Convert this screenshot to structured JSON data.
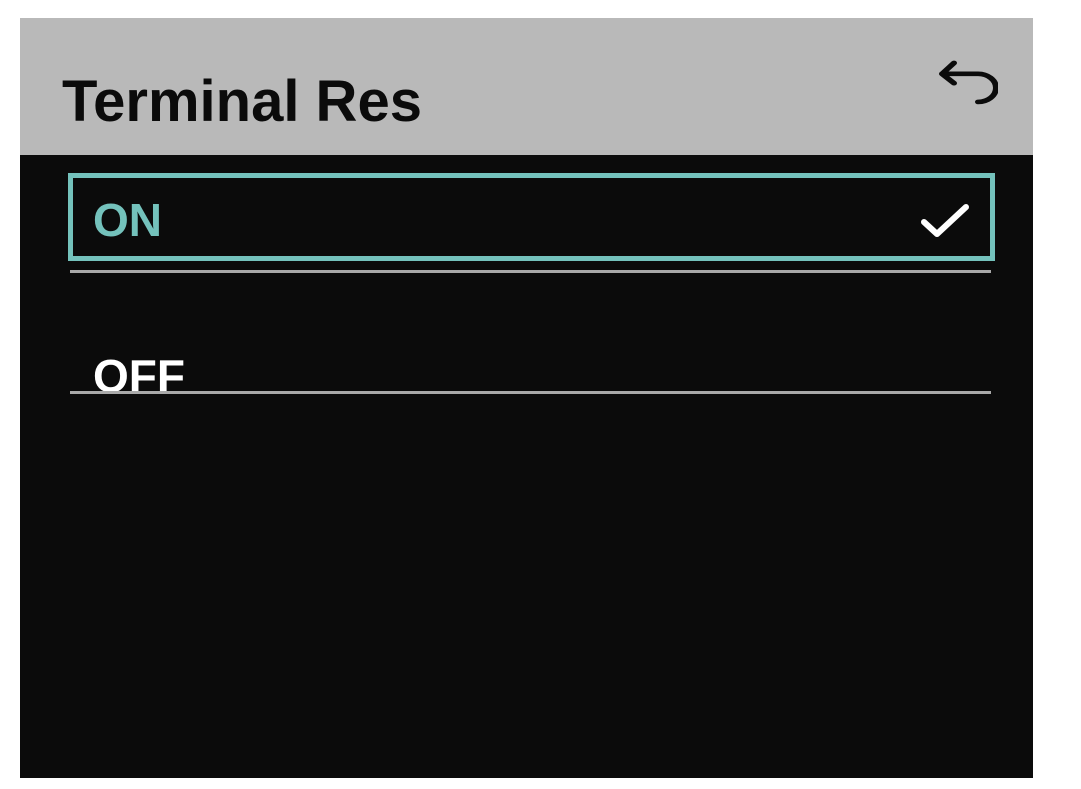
{
  "header": {
    "title": "Terminal Res",
    "back_icon": "back-arrow-icon"
  },
  "options": [
    {
      "label": "ON",
      "selected": true,
      "icon": "checkmark-icon"
    },
    {
      "label": "OFF",
      "selected": false
    }
  ],
  "colors": {
    "header_bg": "#b9b9b9",
    "screen_bg": "#0b0b0b",
    "accent": "#74c2bc",
    "divider": "#a9a9a9",
    "text_default": "#ffffff"
  }
}
